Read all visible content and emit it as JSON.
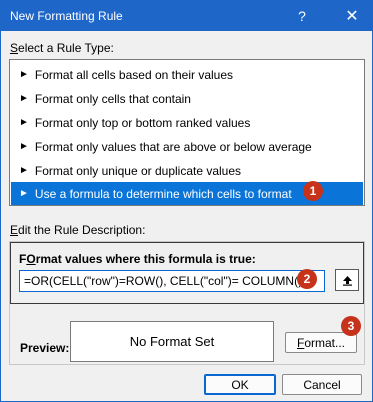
{
  "window": {
    "title": "New Formatting Rule",
    "help_glyph": "?",
    "close_glyph": "✕"
  },
  "rule_type": {
    "section_label_prefix": "",
    "section_label_underlined": "S",
    "section_label_rest": "elect a Rule Type:",
    "items": [
      {
        "label": "Format all cells based on their values"
      },
      {
        "label": "Format only cells that contain"
      },
      {
        "label": "Format only top or bottom ranked values"
      },
      {
        "label": "Format only values that are above or below average"
      },
      {
        "label": "Format only unique or duplicate values"
      },
      {
        "label": "Use a formula to determine which cells to format",
        "selected": true
      }
    ],
    "arrow_glyph": "►"
  },
  "description": {
    "section_label_underlined": "E",
    "section_label_rest": "dit the Rule Description:",
    "formula_label_underlined": "O",
    "formula_label_prefix": "F",
    "formula_label_rest": "rmat values where this formula is true:",
    "formula_value": "=OR(CELL(\"row\")=ROW(), CELL(\"col\")= COLUMN())",
    "preview_label": "Preview:",
    "preview_text": "No Format Set",
    "format_button_underlined": "F",
    "format_button_rest": "ormat..."
  },
  "badges": [
    "1",
    "2",
    "3"
  ],
  "footer": {
    "ok_label": "OK",
    "cancel_label": "Cancel"
  },
  "colors": {
    "titlebar": "#1e66c8",
    "selection": "#0a74d8",
    "badge": "#c7321a"
  }
}
